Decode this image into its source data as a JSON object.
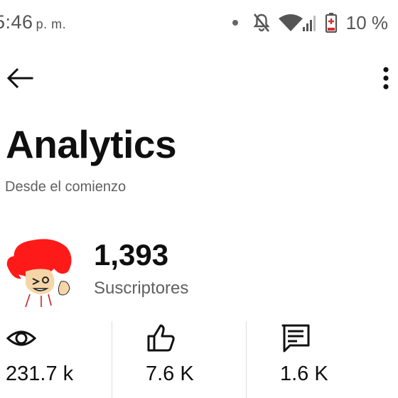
{
  "status_bar": {
    "time": "5:46",
    "ampm": "p. m.",
    "battery": "10 %",
    "icons": [
      "notification-dot-icon",
      "do-not-disturb-bell-icon",
      "wifi-icon",
      "cell-signal-icon",
      "battery-low-icon"
    ],
    "battery_color": "#d32f2f"
  },
  "top_bar": {
    "back_icon": "arrow-left-icon",
    "more_icon": "more-vertical-icon"
  },
  "header": {
    "title": "Analytics",
    "subtitle": "Desde el comienzo"
  },
  "channel": {
    "subscriber_count": "1,393",
    "subscriber_label": "Suscriptores",
    "avatar_colors": {
      "hair": "#ff1a1a",
      "skin": "#f6d6a8"
    }
  },
  "stats": [
    {
      "icon": "eye-icon",
      "value": "231.7 k"
    },
    {
      "icon": "thumbs-up-icon",
      "value": "7.6 K"
    },
    {
      "icon": "comment-icon",
      "value": "1.6 K"
    }
  ]
}
